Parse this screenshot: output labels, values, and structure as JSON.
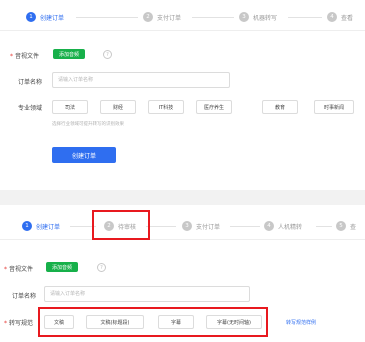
{
  "top_panel": {
    "steps": [
      {
        "num": "1",
        "label": "创建订单"
      },
      {
        "num": "2",
        "label": "支付订单"
      },
      {
        "num": "3",
        "label": "机器转写"
      },
      {
        "num": "4",
        "label": "查看"
      }
    ],
    "audio_file": {
      "label": "音视文件",
      "upload_button": "添加音频",
      "help": "?"
    },
    "order_name": {
      "label": "订单名称",
      "placeholder": "请输入订单名称"
    },
    "domain": {
      "label": "专业领域",
      "options": [
        "司法",
        "财经",
        "IT科技",
        "医疗养生",
        "教育",
        "时事新闻"
      ],
      "hint": "选择行业领域可提升转写的识别效果"
    },
    "submit_button": "创建订单"
  },
  "bottom_panel": {
    "steps": [
      {
        "num": "1",
        "label": "创建订单"
      },
      {
        "num": "2",
        "label": "待审核"
      },
      {
        "num": "3",
        "label": "支付订单"
      },
      {
        "num": "4",
        "label": "人机精转"
      },
      {
        "num": "5",
        "label": "查"
      }
    ],
    "audio_file": {
      "label": "音视文件",
      "upload_button": "添加音频",
      "help": "?"
    },
    "order_name": {
      "label": "订单名称",
      "placeholder": "请输入订单名称"
    },
    "transcription_spec": {
      "label": "转写规范",
      "options": [
        "文稿",
        "文稿(标题段)",
        "字幕",
        "字幕(无时间轴)"
      ],
      "link": "转写规范样例"
    }
  },
  "colors": {
    "primary_blue": "#2f6ef0",
    "upload_green": "#17b04a",
    "highlight_red": "#e8191f",
    "required_red": "#e53935"
  }
}
